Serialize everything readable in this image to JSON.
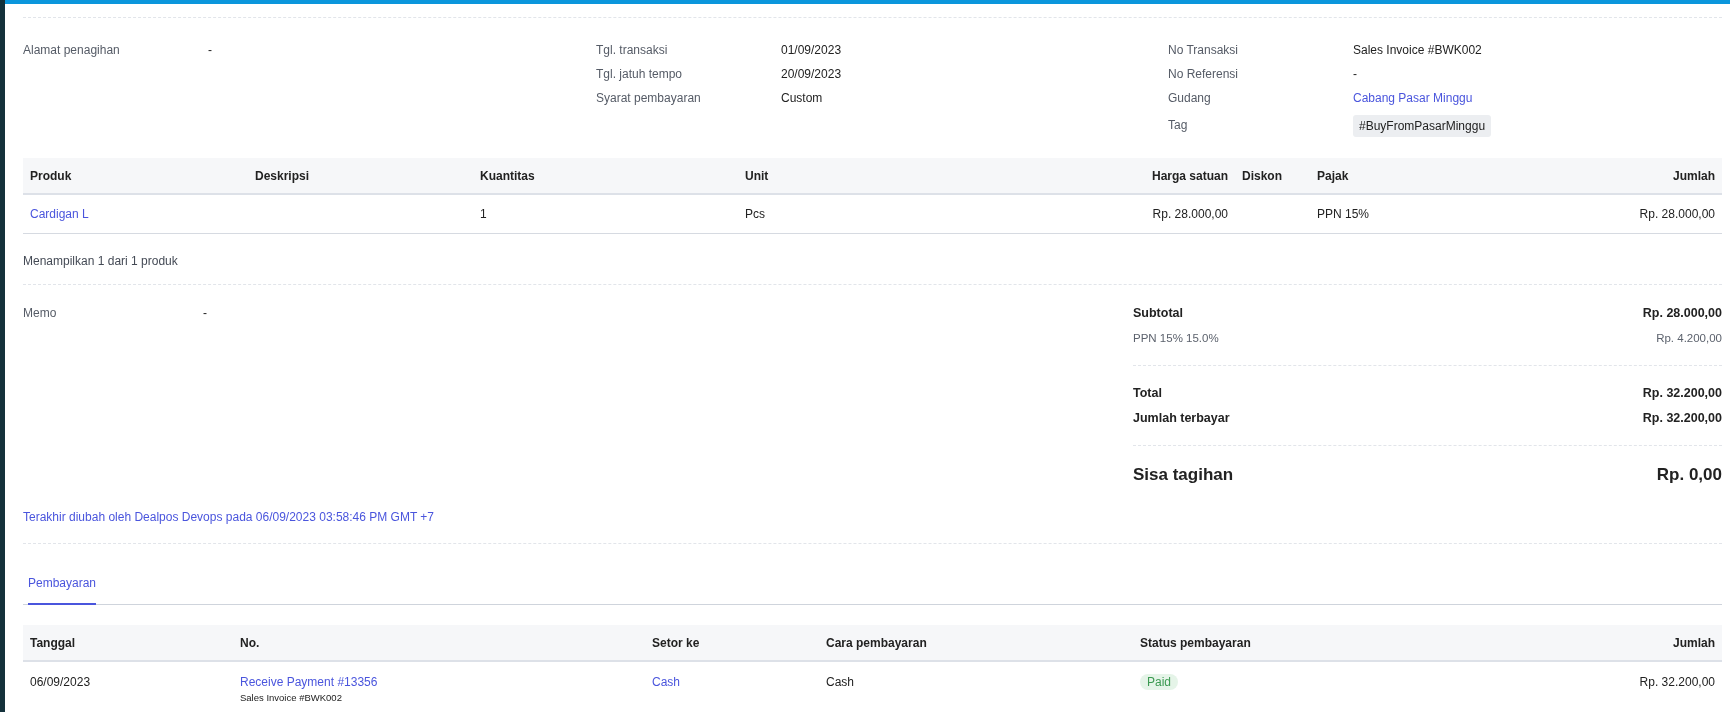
{
  "info_columns": [
    {
      "fields": [
        {
          "label": "Alamat penagihan",
          "value": "-",
          "kind": "text"
        }
      ]
    },
    {
      "fields": [
        {
          "label": "Tgl. transaksi",
          "value": "01/09/2023",
          "kind": "text"
        },
        {
          "label": "Tgl. jatuh tempo",
          "value": "20/09/2023",
          "kind": "text"
        },
        {
          "label": "Syarat pembayaran",
          "value": "Custom",
          "kind": "text"
        }
      ]
    },
    {
      "fields": [
        {
          "label": "No Transaksi",
          "value": "Sales Invoice #BWK002",
          "kind": "text"
        },
        {
          "label": "No Referensi",
          "value": "-",
          "kind": "text"
        },
        {
          "label": "Gudang",
          "value": "Cabang Pasar Minggu",
          "kind": "link"
        },
        {
          "label": "Tag",
          "value": "#BuyFromPasarMinggu",
          "kind": "tag"
        }
      ]
    }
  ],
  "products": {
    "columns": [
      "Produk",
      "Deskripsi",
      "Kuantitas",
      "Unit",
      "Harga satuan",
      "Diskon",
      "Pajak",
      "Jumlah"
    ],
    "rows": [
      {
        "product": "Cardigan L",
        "quantity": "1",
        "unit": "Pcs",
        "unit_price": "Rp. 28.000,00",
        "tax": "PPN 15%",
        "amount": "Rp. 28.000,00"
      }
    ],
    "count": "Menampilkan 1 dari 1 produk"
  },
  "memo": {
    "label": "Memo",
    "value": "-"
  },
  "summary": {
    "groups": [
      [
        {
          "label": "Subtotal",
          "value": "Rp. 28.000,00",
          "kind": "major"
        },
        {
          "label": "PPN 15% 15.0%",
          "value": "Rp. 4.200,00",
          "kind": "minor"
        }
      ],
      [
        {
          "label": "Total",
          "value": "Rp. 32.200,00",
          "kind": "major"
        },
        {
          "label": "Jumlah terbayar",
          "value": "Rp. 32.200,00",
          "kind": "major"
        }
      ],
      [
        {
          "label": "Sisa tagihan",
          "value": "Rp. 0,00",
          "kind": "grand"
        }
      ]
    ]
  },
  "last_modified": "Terakhir diubah oleh Dealpos Devops pada 06/09/2023 03:58:46 PM GMT +7",
  "tabs": [
    {
      "label": "Pembayaran",
      "selected": true
    }
  ],
  "payments": {
    "columns": [
      "Tanggal",
      "No.",
      "Setor ke",
      "Cara pembayaran",
      "Status pembayaran",
      "Jumlah"
    ],
    "rows": [
      {
        "date": "06/09/2023",
        "number": "Receive Payment #13356",
        "reference": "Sales Invoice #BWK002",
        "deposit_to": "Cash",
        "method": "Cash",
        "status": {
          "text": "Paid",
          "kind": "paid"
        },
        "amount": "Rp. 32.200,00"
      }
    ]
  }
}
